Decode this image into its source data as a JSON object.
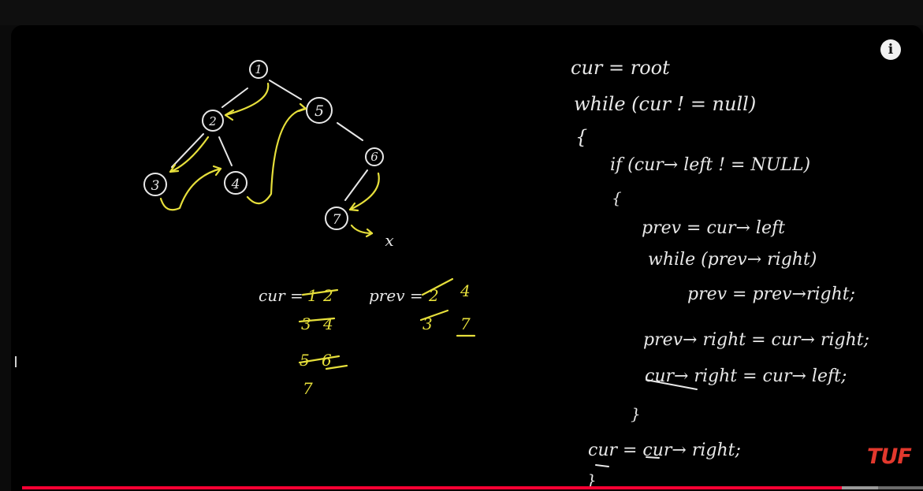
{
  "player": {
    "info_label": "i",
    "logo_text": "TUF",
    "progress": 0.91,
    "buffered": 0.95,
    "accent_color": "#ff0033"
  },
  "whiteboard": {
    "tree_nodes": [
      "1",
      "2",
      "5",
      "3",
      "4",
      "6",
      "7"
    ],
    "null_label": "x",
    "trace": {
      "cur_label": "cur =",
      "cur_values": [
        "1",
        "2",
        "3",
        "4",
        "5",
        "6",
        "7"
      ],
      "prev_label": "prev =",
      "prev_values": [
        "2",
        "4",
        "3",
        "7"
      ]
    },
    "code_lines": [
      "cur = root",
      "while (cur ! = null)",
      "{",
      "if (cur→ left ! = NULL)",
      "{",
      "prev = cur→ left",
      "while (prev→ right)",
      "prev = prev→right;",
      "prev→ right = cur→ right;",
      "cur→ right = cur→ left;",
      "}",
      "cur = cur→ right;",
      "}"
    ]
  }
}
